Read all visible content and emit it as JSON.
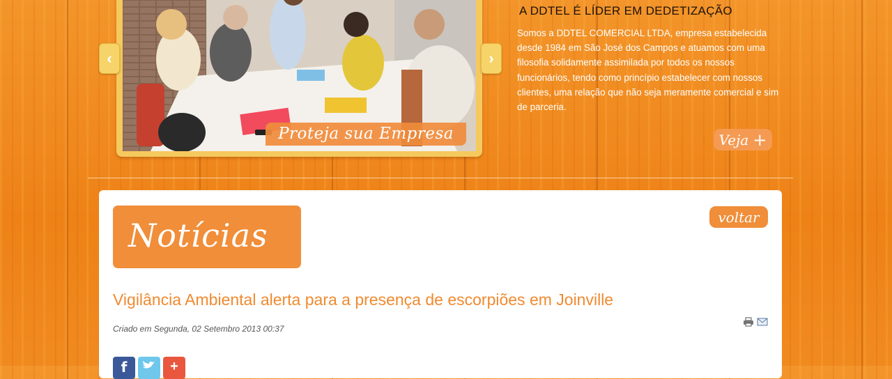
{
  "slider": {
    "caption": "Proteja sua Empresa",
    "prev_icon": "chevron-left-icon",
    "next_icon": "chevron-right-icon"
  },
  "about": {
    "title": "A DDTEL É LÍDER EM DEDETIZAÇÃO",
    "text": "Somos a DDTEL COMERCIAL LTDA, empresa estabelecida desde 1984 em São José dos Campos e atuamos com uma filosofia solidamente assimilada por todos os nossos funcionários, tendo como princípio estabelecer com nossos clientes, uma relação que não seja meramente comercial e sim de parceria.",
    "more_label": "Veja",
    "more_icon": "plus-icon"
  },
  "content": {
    "section_title": "Notícias",
    "back_label": "voltar",
    "article": {
      "title": "Vigilância Ambiental alerta para a presença de escorpiões em Joinville",
      "date": "Criado em Segunda, 02 Setembro 2013 00:37"
    },
    "tools": [
      "print-icon",
      "email-icon"
    ],
    "share": [
      "facebook-icon",
      "twitter-icon",
      "google-plus-icon"
    ]
  },
  "colors": {
    "background": "#f08a1c",
    "accent": "#f08e3a",
    "title_orange": "#f08a30",
    "slider_frame": "#f6c95e"
  }
}
